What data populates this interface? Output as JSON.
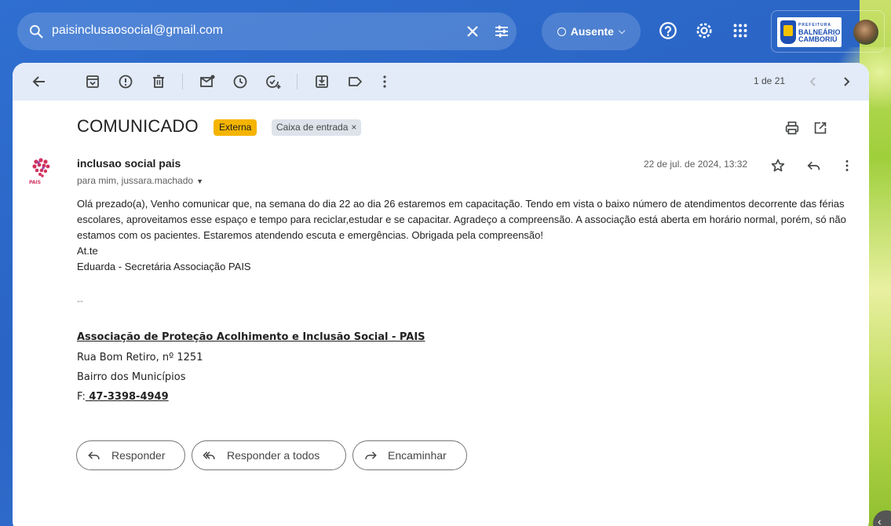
{
  "search": {
    "query": "paisinclusaosocial@gmail.com",
    "icon": "search-icon"
  },
  "status": {
    "label": "Ausente"
  },
  "brand": {
    "line1": "PREFEITURA",
    "line2": "BALNEÁRIO",
    "line3": "CAMBORIÚ"
  },
  "pager": {
    "text": "1 de 21"
  },
  "email": {
    "subject": "COMUNICADO",
    "labels": {
      "external": "Externa",
      "inbox": "Caixa de entrada",
      "inbox_remove": "×"
    },
    "sender": "inclusao social pais",
    "recipients": "para mim, jussara.machado",
    "date": "22 de jul. de 2024, 13:32",
    "body": [
      "Olá prezado(a), Venho comunicar que, na semana do dia 22 ao dia 26 estaremos em capacitação. Tendo em vista o baixo número de atendimentos decorrente das férias escolares, aproveitamos esse espaço e tempo para reciclar,estudar e se capacitar. Agradeço a compreensão. A associação está aberta em horário normal, porém, só não estamos com os pacientes. Estaremos atendendo escuta e emergências. Obrigada pela compreensão!",
      "At.te",
      "Eduarda - Secretária Associação PAIS"
    ],
    "dashes": "--",
    "signature": {
      "org": "Associação de Proteção Acolhimento e Inclusão Social - PAIS",
      "address": "Rua Bom Retiro, nº 1251",
      "district": "Bairro dos Municípios",
      "phone_prefix": "F:",
      "phone": " 47-3398-4949"
    }
  },
  "actions": {
    "reply": "Responder",
    "reply_all": "Responder a todos",
    "forward": "Encaminhar"
  },
  "colors": {
    "accent_blue": "#2f6fd0",
    "toolbar_bg": "#e3ebf8",
    "external_badge": "#f4b400",
    "inbox_badge": "#dde3ea"
  }
}
